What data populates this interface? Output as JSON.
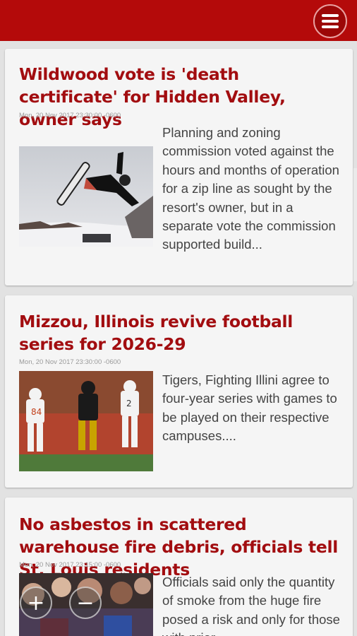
{
  "menu": {
    "icon": "menu-icon"
  },
  "articles": [
    {
      "title": "Wildwood vote is 'death certificate' for Hidden Valley, owner says",
      "date": "Mon, 20 Nov 2017 23:30:00 -0600",
      "summary": "Planning and zoning commission voted against the hours and months of operation for a zip line as sought by the resort's owner, but in a separate vote the commission supported build...",
      "image": "snowboarder-jump-photo"
    },
    {
      "title": "Mizzou, Illinois revive football series for 2026-29",
      "date": "Mon, 20 Nov 2017 23:30:00 -0600",
      "summary": "Tigers, Fighting Illini agree to four-year series with games to be played on their respective campuses....",
      "image": "football-players-photo"
    },
    {
      "title": "No asbestos in scattered warehouse fire debris, officials tell St. Louis residents",
      "date": "Mon, 20 Nov 2017 23:15:00 -0600",
      "summary": "Officials said only the quantity of smoke from the huge fire posed a risk and only for those with prior",
      "image": "crowd-meeting-photo"
    }
  ],
  "zoom": {
    "in_icon": "zoom-in-icon",
    "out_icon": "zoom-out-icon",
    "in_label": "+",
    "out_label": "−"
  }
}
